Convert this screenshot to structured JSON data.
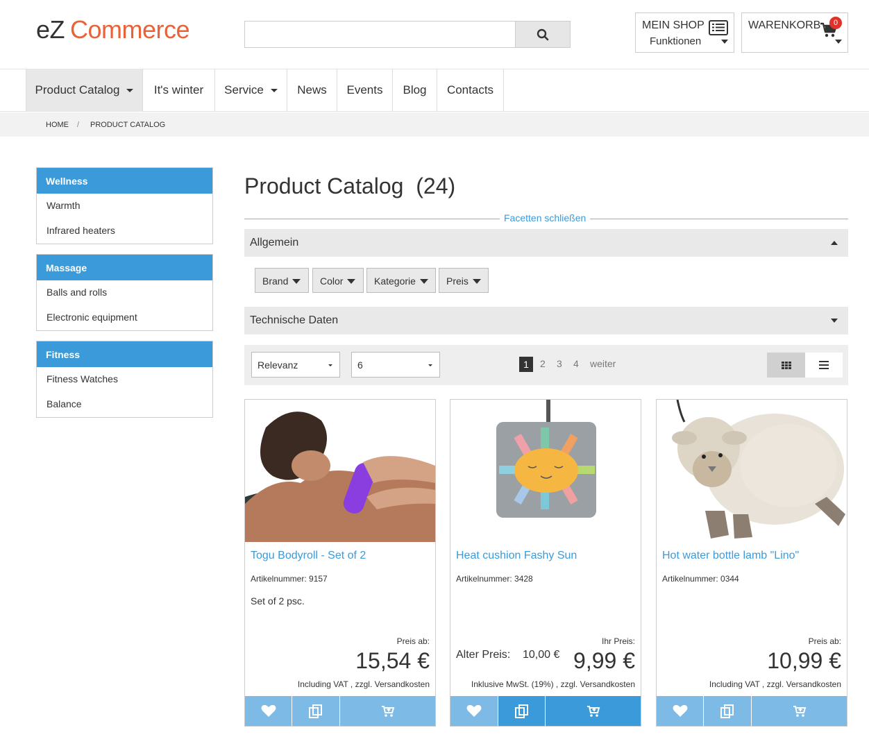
{
  "header": {
    "logo_ez": "eZ",
    "logo_commerce": "Commerce",
    "search_placeholder": "",
    "myshop_title": "MEIN SHOP",
    "myshop_sub": "Funktionen",
    "cart_title": "WARENKORB",
    "cart_count": "0"
  },
  "nav": {
    "items": [
      {
        "label": "Product Catalog"
      },
      {
        "label": "It's winter"
      },
      {
        "label": "Service"
      },
      {
        "label": "News"
      },
      {
        "label": "Events"
      },
      {
        "label": "Blog"
      },
      {
        "label": "Contacts"
      }
    ]
  },
  "breadcrumb": {
    "home": "HOME",
    "sep": "/",
    "current": "PRODUCT CATALOG"
  },
  "sidebar": [
    {
      "heading": "Wellness",
      "links": [
        "Warmth",
        "Infrared heaters"
      ]
    },
    {
      "heading": "Massage",
      "links": [
        "Balls and rolls",
        "Electronic equipment"
      ]
    },
    {
      "heading": "Fitness",
      "links": [
        "Fitness Watches",
        "Balance"
      ]
    }
  ],
  "main": {
    "title": "Product Catalog",
    "count": "(24)",
    "facets_toggle": "Facetten schließen",
    "accordion_general": "Allgemein",
    "accordion_tech": "Technische Daten",
    "filters": [
      "Brand",
      "Color",
      "Kategorie",
      "Preis"
    ],
    "sort_value": "Relevanz",
    "per_page_value": "6",
    "pages": [
      "1",
      "2",
      "3",
      "4"
    ],
    "next_label": "weiter"
  },
  "products": [
    {
      "name": "Togu Bodyroll - Set of 2",
      "sku": "Artikelnummer: 9157",
      "desc": "Set of 2 psc.",
      "price_label": "Preis ab:",
      "price": "15,54 €",
      "vat": "Including VAT , zzgl. Versandkosten"
    },
    {
      "name": "Heat cushion Fashy Sun",
      "sku": "Artikelnummer: 3428",
      "desc": "",
      "old_label": "Alter Preis:",
      "old_price": "10,00 €",
      "price_label": "Ihr Preis:",
      "price": "9,99 €",
      "vat": "Inklusive MwSt. (19%) , zzgl. Versandkosten"
    },
    {
      "name": "Hot water bottle lamb \"Lino\"",
      "sku": "Artikelnummer: 0344",
      "desc": "",
      "price_label": "Preis ab:",
      "price": "10,99 €",
      "vat": "Including VAT , zzgl. Versandkosten"
    }
  ],
  "colors": {
    "accent": "#3b9ad9",
    "brand_orange": "#e8623a",
    "badge_red": "#e0312a",
    "action_light": "#7dbbe6"
  }
}
